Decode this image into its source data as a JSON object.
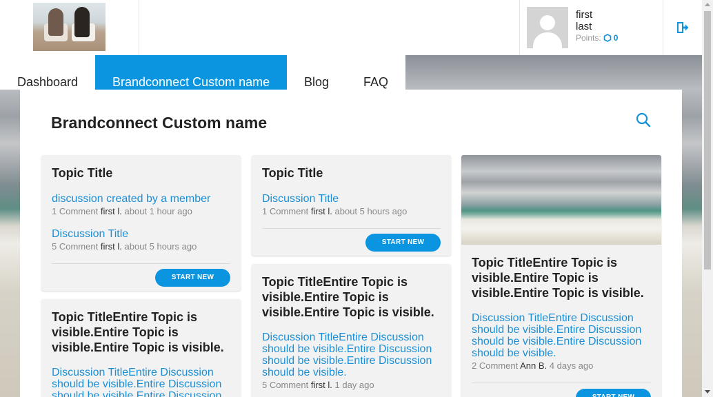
{
  "header": {
    "user": {
      "first": "first",
      "last": "last",
      "points_label": "Points:",
      "points_value": "0"
    }
  },
  "nav": {
    "items": [
      {
        "label": "Dashboard"
      },
      {
        "label": "Brandconnect Custom name"
      },
      {
        "label": "Blog"
      },
      {
        "label": "FAQ"
      }
    ]
  },
  "main": {
    "title": "Brandconnect Custom name",
    "cards": [
      {
        "title": "Topic Title",
        "discussions": [
          {
            "title": "discussion created by a member",
            "count": "1 Comment",
            "author": "first l.",
            "time": "about 1 hour ago"
          },
          {
            "title": "Discussion Title",
            "count": "5 Comment",
            "author": "first l.",
            "time": "about 5 hours ago"
          }
        ],
        "button": "START NEW"
      },
      {
        "title": "Topic Title",
        "discussions": [
          {
            "title": "Discussion Title",
            "count": "1 Comment",
            "author": "first l.",
            "time": "about 5 hours ago"
          }
        ],
        "button": "START NEW"
      },
      {
        "title": "Topic TitleEntire Topic is visible.Entire Topic is visible.Entire Topic is visible.",
        "discussions": [
          {
            "title": "Discussion TitleEntire Discussion should be visible.Entire Discussion should be visible.Entire Discussion should be visible.",
            "count": "2 Comment",
            "author": "Ann B.",
            "time": "4 days ago"
          }
        ],
        "button": "START NEW"
      },
      {
        "title": "Topic TitleEntire Topic is visible.Entire Topic is visible.Entire Topic is visible.",
        "discussions": [
          {
            "title": "Discussion TitleEntire Discussion should be visible.Entire Discussion should be visible.Entire Discussion should be visible.",
            "count": "5 Comment",
            "author": "first l.",
            "time": "1 day ago"
          }
        ]
      },
      {
        "title": "Topic TitleEntire Topic is visible.Entire Topic is visible.Entire Topic is visible.",
        "discussions": [
          {
            "title": "Discussion TitleEntire Discussion should be visible.Entire Discussion should be visible.Entire Discussion"
          }
        ]
      }
    ]
  },
  "colors": {
    "accent": "#0b95e0",
    "link": "#1b8fd6"
  },
  "icons": {
    "search": "search-icon",
    "logout": "logout-icon",
    "points": "points-icon"
  }
}
